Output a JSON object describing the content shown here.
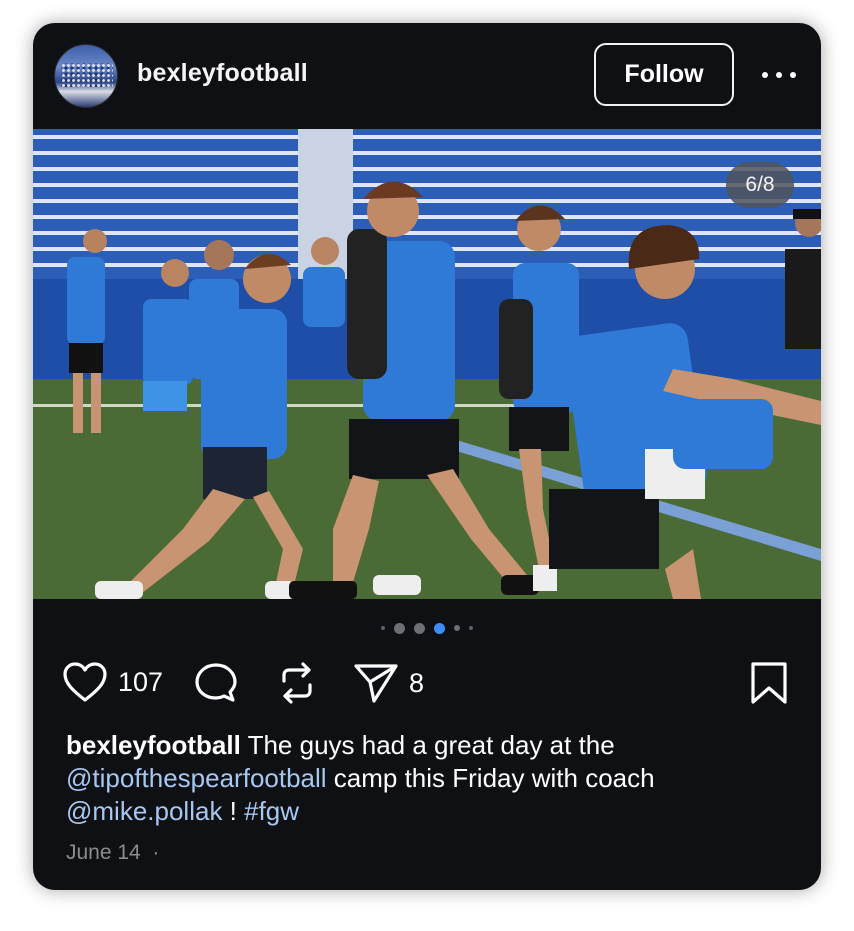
{
  "post": {
    "username": "bexleyfootball",
    "follow_label": "Follow",
    "image_counter": "6/8",
    "carousel": {
      "total_dots": 6,
      "active_index": 3
    },
    "likes": "107",
    "shares": "8",
    "caption": {
      "user": "bexleyfootball",
      "text_1": " The guys had a great day at the",
      "mention_1": "@tipofthespearfootball",
      "text_2": " camp this Friday with coach",
      "mention_2": "@mike.pollak",
      "text_3": " ! ",
      "hashtag": "#fgw"
    },
    "date": "June 14",
    "date_sep": "·"
  },
  "icons": {
    "like": "heart-icon",
    "comment": "comment-bubble-icon",
    "repost": "repost-icon",
    "share": "send-icon",
    "save": "bookmark-icon",
    "more": "more-options-icon"
  },
  "colors": {
    "card_bg": "#0f1013",
    "link": "#a7c7f0",
    "active_dot": "#3d8df5",
    "jersey_blue": "#2f7ad6"
  }
}
